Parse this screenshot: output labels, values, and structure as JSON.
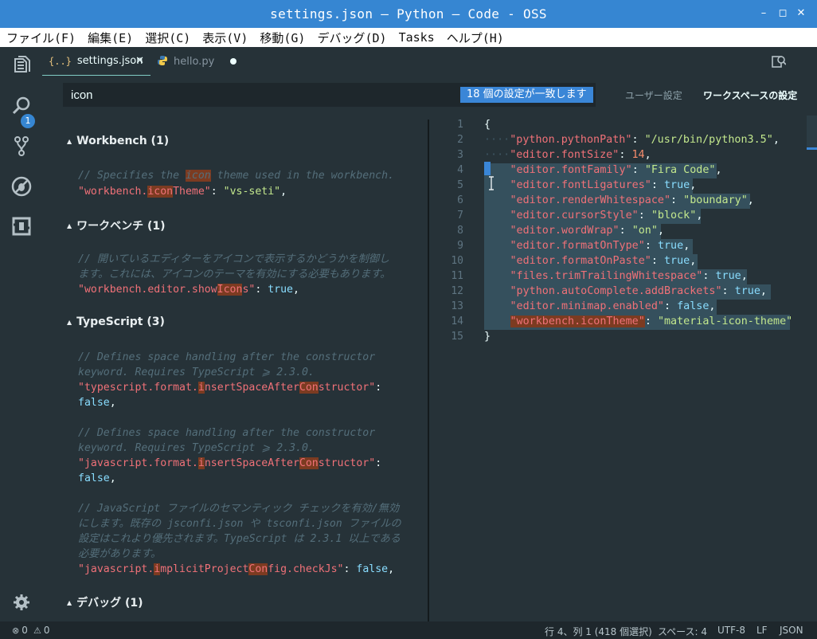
{
  "window": {
    "title": "settings.json — Python — Code - OSS",
    "controls": {
      "minimize": "–",
      "maximize": "◻",
      "close": "✕"
    }
  },
  "menu": [
    "ファイル(F)",
    "編集(E)",
    "選択(C)",
    "表示(V)",
    "移動(G)",
    "デバッグ(D)",
    "Tasks",
    "ヘルプ(H)"
  ],
  "activity": {
    "items": [
      "explorer-icon",
      "search-icon",
      "source-control-icon",
      "debug-icon",
      "extensions-icon"
    ],
    "badge": "1",
    "manage": "gear-icon"
  },
  "tabs": [
    {
      "icon": "{..}",
      "label": "settings.json",
      "close": "✕",
      "active": true
    },
    {
      "icon": "python-icon",
      "label": "hello.py",
      "dirty": true,
      "active": false
    }
  ],
  "search": {
    "value": "icon",
    "placeholder": "",
    "match_badge": "18 個の設定が一致します",
    "scope_user": "ユーザー設定",
    "scope_workspace": "ワークスペースの設定"
  },
  "settings_sections": [
    {
      "header": "Workbench (1)"
    },
    {
      "header": "ワークベンチ (1)"
    },
    {
      "header": "TypeScript (3)"
    },
    {
      "header": "デバッグ (1)"
    }
  ],
  "settings_lines": {
    "s1c1a": "// Specifies the ",
    "s1c1b": "icon",
    "s1c1c": " theme used in the workbench.",
    "s1k1": "\"workbench.",
    "s1k2": "icon",
    "s1k3": "Theme\"",
    "s1p1": ": ",
    "s1v": "\"vs-seti\"",
    "s1p2": ",",
    "s2c1": "// 開いているエディターをアイコンで表示するかどうかを制御し",
    "s2c2": "ます。これには、アイコンのテーマを有効にする必要もあります。",
    "s2k1": "\"workbench.editor.show",
    "s2k2": "Icon",
    "s2k3": "s\"",
    "s2p1": ": ",
    "s2v": "true",
    "s2p2": ",",
    "s3c1": "// Defines space handling after the constructor",
    "s3c2": "keyword. Requires TypeScript ⩾ 2.3.0.",
    "s3k1": "\"typescript.format.",
    "s3k2": "i",
    "s3k3": "nsertSpaceAfter",
    "s3k4": "Con",
    "s3k5": "structor\"",
    "s3p1": ":",
    "s3v": "false",
    "s3p2": ",",
    "s4c1": "// Defines space handling after the constructor",
    "s4c2": "keyword. Requires TypeScript ⩾ 2.3.0.",
    "s4k1": "\"javascript.format.",
    "s4k2": "i",
    "s4k3": "nsertSpaceAfter",
    "s4k4": "Con",
    "s4k5": "structor\"",
    "s4p1": ":",
    "s4v": "false",
    "s4p2": ",",
    "s5c1": "// JavaScript ファイルのセマンティック チェックを有効/無効",
    "s5c2": "にします。既存の jsconfi.json や tsconfi.json ファイルの",
    "s5c3": "設定はこれより優先されます。TypeScript は 2.3.1 以上である",
    "s5c4": "必要があります。",
    "s5k1": "\"javascript.",
    "s5k2": "i",
    "s5k3": "mplicitProject",
    "s5k4": "Con",
    "s5k5": "fig.checkJs\"",
    "s5p1": ": ",
    "s5v": "false",
    "s5p2": ","
  },
  "editor": {
    "line_numbers": [
      "1",
      "2",
      "3",
      "4",
      "5",
      "6",
      "7",
      "8",
      "9",
      "10",
      "11",
      "12",
      "13",
      "14",
      "15"
    ],
    "open_brace": "{",
    "close_brace": "}",
    "dots": "····",
    "entries": [
      {
        "key": "\"python.pythonPath\"",
        "value": "\"/usr/bin/python3.5\"",
        "type": "str",
        "comma": ","
      },
      {
        "key": "\"editor.fontSize\"",
        "value": "14",
        "type": "num",
        "comma": ","
      },
      {
        "key": "\"editor.fontFamily\"",
        "value": "\"Fira Code\"",
        "type": "str",
        "comma": ","
      },
      {
        "key": "\"editor.fontLigatures\"",
        "value": "true",
        "type": "kw",
        "comma": ","
      },
      {
        "key": "\"editor.renderWhitespace\"",
        "value": "\"boundary\"",
        "type": "str",
        "comma": ","
      },
      {
        "key": "\"editor.cursorStyle\"",
        "value": "\"block\"",
        "type": "str",
        "comma": ","
      },
      {
        "key": "\"editor.wordWrap\"",
        "value": "\"on\"",
        "type": "str",
        "comma": ","
      },
      {
        "key": "\"editor.formatOnType\"",
        "value": "true",
        "type": "kw",
        "comma": ","
      },
      {
        "key": "\"editor.formatOnPaste\"",
        "value": "true",
        "type": "kw",
        "comma": ","
      },
      {
        "key": "\"files.trimTrailingWhitespace\"",
        "value": "true",
        "type": "kw",
        "comma": ","
      },
      {
        "key": "\"python.autoComplete.addBrackets\"",
        "value": "true",
        "type": "kw",
        "comma": ","
      },
      {
        "key": "\"editor.minimap.enabled\"",
        "value": "false",
        "type": "kw",
        "comma": ","
      },
      {
        "key": "\"workbench.iconTheme\"",
        "value": "\"material-icon-theme\"",
        "type": "str",
        "comma": ""
      }
    ],
    "colon": ": "
  },
  "status": {
    "errors": "0",
    "warnings": "0",
    "position": "行 4、列 1 (418 個選択)",
    "spaces": "スペース: 4",
    "encoding": "UTF-8",
    "eol": "LF",
    "language": "JSON"
  },
  "colors": {
    "titlebar": "#3686d2",
    "accent": "#3a86d7",
    "background": "#263238",
    "key": "#f07178",
    "string": "#c3e88d",
    "keyword": "#89ddff",
    "number": "#f78c6c",
    "comment": "#546e7a",
    "match_highlight": "#7c3b21"
  }
}
